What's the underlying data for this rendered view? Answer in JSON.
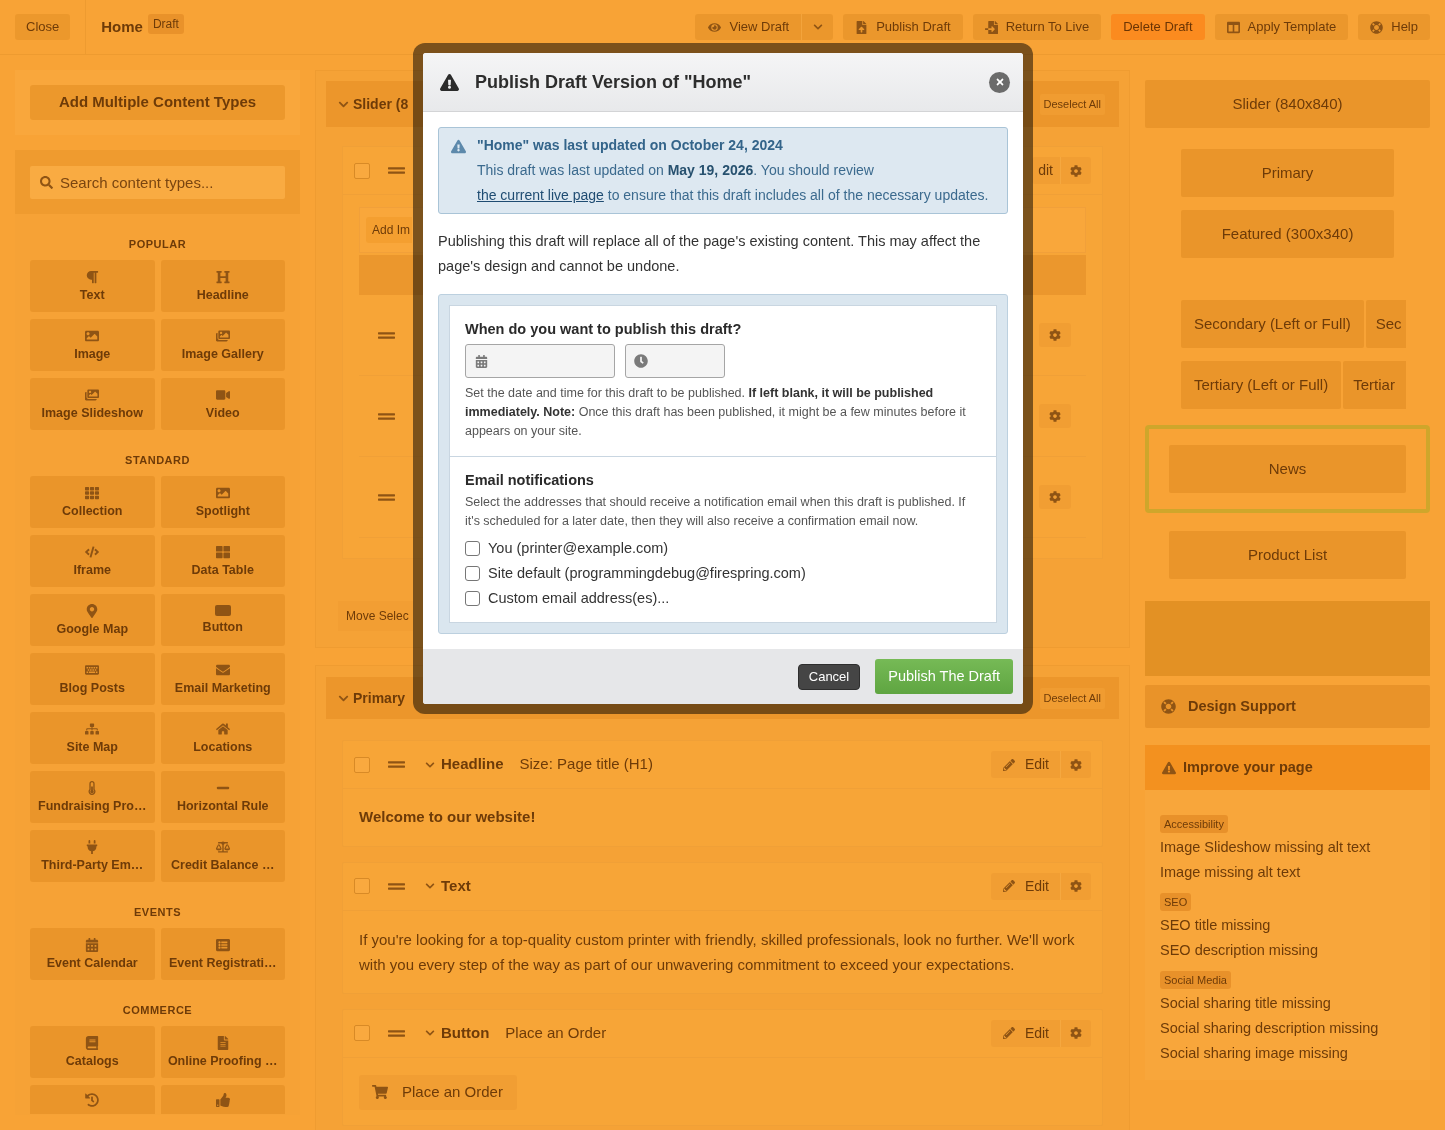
{
  "top_bar": {
    "close_button": "Close",
    "page_title": "Home",
    "status_badge": "Draft",
    "actions": [
      {
        "label": "View Draft",
        "kind": "split"
      },
      {
        "label": "Publish Draft",
        "kind": "normal"
      },
      {
        "label": "Return To Live",
        "kind": "normal"
      },
      {
        "label": "Delete Draft",
        "kind": "danger"
      },
      {
        "label": "Apply Template",
        "kind": "normal"
      },
      {
        "label": "Help",
        "kind": "normal"
      }
    ]
  },
  "sidebar": {
    "add_button": "Add Multiple Content Types",
    "search": {
      "placeholder": "Search content types..."
    },
    "groups": [
      {
        "title": "POPULAR",
        "items": [
          "Text",
          "Headline",
          "Image",
          "Image Gallery",
          "Image Slideshow",
          "Video"
        ],
        "cut_row": false
      },
      {
        "title": "STANDARD",
        "items": [
          "Collection",
          "Spotlight",
          "Iframe",
          "Data Table",
          "Google Map",
          "Button",
          "Blog Posts",
          "Email Marketing",
          "Site Map",
          "Locations",
          "Fundraising Pro…",
          "Horizontal Rule",
          "Third-Party Em…",
          "Credit Balance …"
        ],
        "cut_row": false
      },
      {
        "title": "EVENTS",
        "items": [
          "Event Calendar",
          "Event Registrati…"
        ],
        "cut_row": false
      },
      {
        "title": "COMMERCE",
        "items": [
          "Catalogs",
          "Online Proofing …"
        ],
        "cut_row": true
      }
    ]
  },
  "editor": {
    "slider_section": {
      "title": "Slider (8",
      "expanded": true,
      "deselect_button": "Deselect All",
      "row": {
        "checked": false,
        "edit_button": "dit"
      },
      "add_button": "Add Im",
      "move_button": "Move Selec"
    },
    "primary_section": {
      "title": "Primary",
      "expanded": true,
      "deselect_button": "Deselect All",
      "blocks": [
        {
          "kind": "headline",
          "title": "Headline",
          "summary": "Size: Page title (H1)",
          "checked": false,
          "expanded": true,
          "edit_button": "Edit",
          "content": "Welcome to our website!"
        },
        {
          "kind": "text",
          "title": "Text",
          "checked": false,
          "expanded": true,
          "edit_button": "Edit",
          "content": "If you're looking for a top-quality custom printer with friendly, skilled professionals, look no further. We'll work with you every step of the way as part of our unwavering commitment to exceed your expectations."
        },
        {
          "kind": "button",
          "title": "Button",
          "summary": "Place an Order",
          "checked": false,
          "expanded": true,
          "edit_button": "Edit",
          "content": "Place an Order"
        }
      ]
    }
  },
  "layout_map": {
    "rows": [
      {
        "kind": "wide",
        "labels": [
          "Slider (840x840)"
        ],
        "selected": false
      },
      {
        "kind": "inset",
        "labels": [
          "Primary"
        ],
        "selected": false
      },
      {
        "kind": "inset",
        "labels": [
          "Featured (300x340)"
        ],
        "selected": false
      },
      {
        "kind": "split",
        "labels": [
          "Secondary (Left or Full)",
          "Sec"
        ],
        "selected": false
      },
      {
        "kind": "split",
        "labels": [
          "Tertiary (Left or Full)",
          "Tertiar"
        ],
        "selected": false
      },
      {
        "kind": "plain",
        "labels": [
          "News"
        ],
        "selected": true
      },
      {
        "kind": "plain",
        "labels": [
          "Product List"
        ],
        "selected": false
      },
      {
        "kind": "blank",
        "selected": false
      }
    ]
  },
  "support_button": "Design Support",
  "improve_panel": {
    "title": "Improve your page",
    "groups": [
      {
        "tag": "Accessibility",
        "issues": [
          "Image Slideshow missing alt text",
          "Image missing alt text"
        ]
      },
      {
        "tag": "SEO",
        "issues": [
          "SEO title missing",
          "SEO description missing"
        ]
      },
      {
        "tag": "Social Media",
        "issues": [
          "Social sharing title missing",
          "Social sharing description missing",
          "Social sharing image missing"
        ]
      }
    ]
  },
  "dialog": {
    "title": "Publish Draft Version of \"Home\"",
    "notice": {
      "heading": "\"Home\" was last updated on October 24, 2024",
      "text": "This draft was last updated on **May 19, 2026**. You should review ",
      "link": "the current live page",
      "text_end": " to ensure that this draft includes all of the necessary updates."
    },
    "message": "Publishing this draft will replace all of the page's existing content. This may affect the page's design and cannot be undone.",
    "schedule": {
      "heading": "When do you want to publish this draft?",
      "help": "Set the date and time for this draft to be published. **If left blank, it will be published immediately. Note:** Once this draft has been published, it might be a few minutes before it appears on your site."
    },
    "email": {
      "heading": "Email notifications",
      "help": "Select the addresses that should receive a notification email when this draft is published. If it's scheduled for a later date, then they will also receive a confirmation email now.",
      "options": [
        {
          "label": "You (printer@example.com)",
          "checked": false
        },
        {
          "label": "Site default (programmingdebug@firespring.com)",
          "checked": false
        },
        {
          "label": "Custom email address(es)...",
          "checked": false
        }
      ]
    },
    "buttons": [
      {
        "label": "Cancel",
        "kind": "secondary"
      },
      {
        "label": "Publish The Draft",
        "kind": "primary"
      }
    ]
  }
}
